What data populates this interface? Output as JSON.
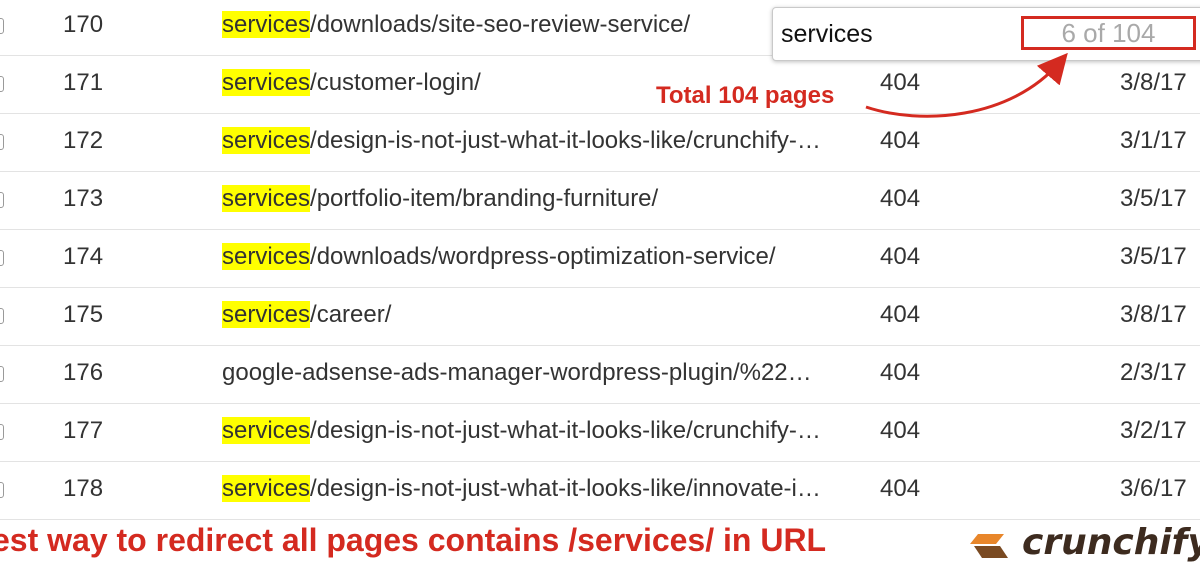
{
  "rows": [
    {
      "num": "170",
      "highlight": "services",
      "path": "/downloads/site-seo-review-service/",
      "code": "",
      "date": ""
    },
    {
      "num": "171",
      "highlight": "services",
      "path": "/customer-login/",
      "code": "404",
      "date": "3/8/17"
    },
    {
      "num": "172",
      "highlight": "services",
      "path": "/design-is-not-just-what-it-looks-like/crunchify-…",
      "code": "404",
      "date": "3/1/17"
    },
    {
      "num": "173",
      "highlight": "services",
      "path": "/portfolio-item/branding-furniture/",
      "code": "404",
      "date": "3/5/17"
    },
    {
      "num": "174",
      "highlight": "services",
      "path": "/downloads/wordpress-optimization-service/",
      "code": "404",
      "date": "3/5/17"
    },
    {
      "num": "175",
      "highlight": "services",
      "path": "/career/",
      "code": "404",
      "date": "3/8/17"
    },
    {
      "num": "176",
      "highlight": "",
      "path": "google-adsense-ads-manager-wordpress-plugin/%22…",
      "code": "404",
      "date": "2/3/17"
    },
    {
      "num": "177",
      "highlight": "services",
      "path": "/design-is-not-just-what-it-looks-like/crunchify-…",
      "code": "404",
      "date": "3/2/17"
    },
    {
      "num": "178",
      "highlight": "services",
      "path": "/design-is-not-just-what-it-looks-like/innovate-i…",
      "code": "404",
      "date": "3/6/17"
    }
  ],
  "find_bar": {
    "query": "services",
    "match_count": "6 of 104"
  },
  "annotation": "Total 104 pages",
  "caption": "est way to redirect all pages contains /services/ in URL",
  "brand": {
    "name": "crunchify",
    "suffix": ".",
    "colors": {
      "orange": "#e8862a",
      "brown": "#7a4a22",
      "dark": "#3d2b1f"
    }
  },
  "colors": {
    "highlight": "#ffff00",
    "annotation": "#d42a20"
  }
}
